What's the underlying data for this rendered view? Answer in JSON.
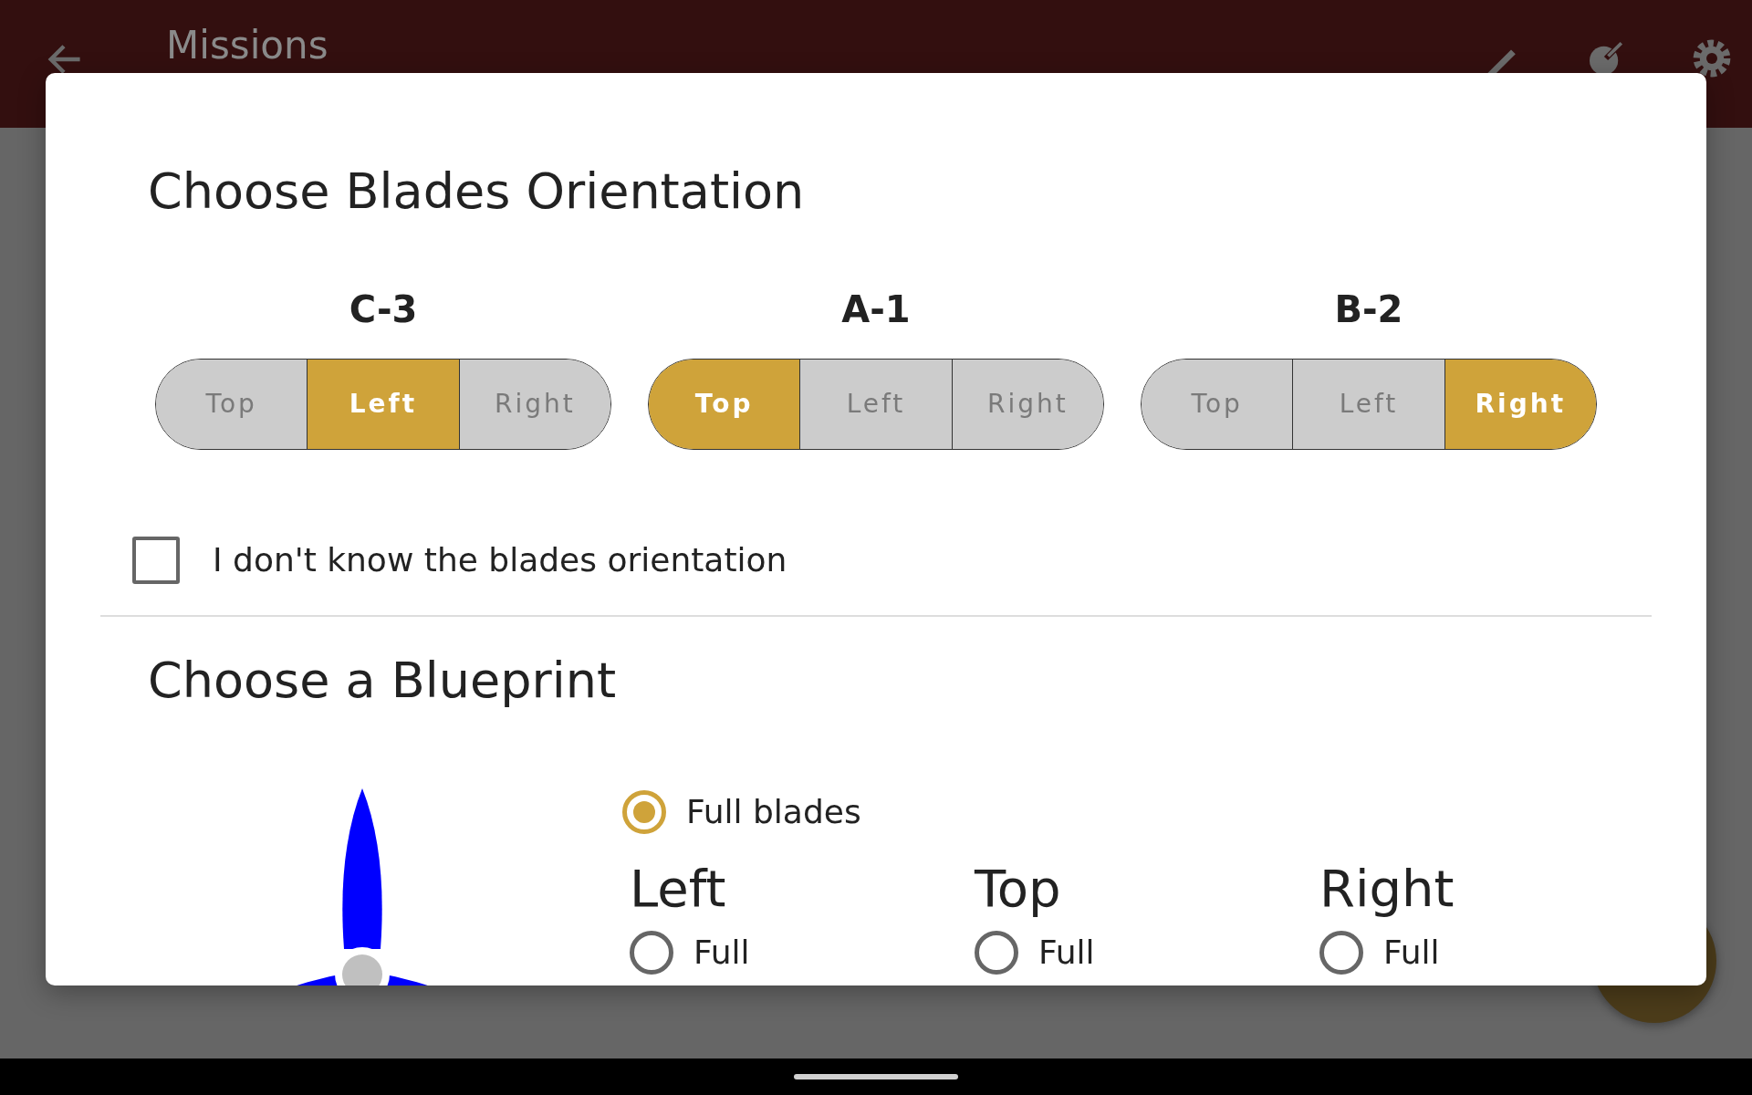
{
  "app_bar": {
    "title": "Missions"
  },
  "dialog": {
    "title": "Choose Blades Orientation",
    "blades": [
      {
        "label": "C-3",
        "options": [
          {
            "label": "Top",
            "selected": false
          },
          {
            "label": "Left",
            "selected": true
          },
          {
            "label": "Right",
            "selected": false
          }
        ]
      },
      {
        "label": "A-1",
        "options": [
          {
            "label": "Top",
            "selected": true
          },
          {
            "label": "Left",
            "selected": false
          },
          {
            "label": "Right",
            "selected": false
          }
        ]
      },
      {
        "label": "B-2",
        "options": [
          {
            "label": "Top",
            "selected": false
          },
          {
            "label": "Left",
            "selected": false
          },
          {
            "label": "Right",
            "selected": true
          }
        ]
      }
    ],
    "unknown_checkbox": {
      "label": "I don't know the blades orientation",
      "checked": false
    },
    "blueprint": {
      "title": "Choose a Blueprint",
      "full_blades": {
        "label": "Full blades",
        "selected": true
      },
      "columns": [
        {
          "heading": "Left",
          "options": [
            {
              "label": "Full",
              "selected": false
            }
          ]
        },
        {
          "heading": "Top",
          "options": [
            {
              "label": "Full",
              "selected": false
            }
          ]
        },
        {
          "heading": "Right",
          "options": [
            {
              "label": "Full",
              "selected": false
            }
          ]
        }
      ]
    }
  }
}
